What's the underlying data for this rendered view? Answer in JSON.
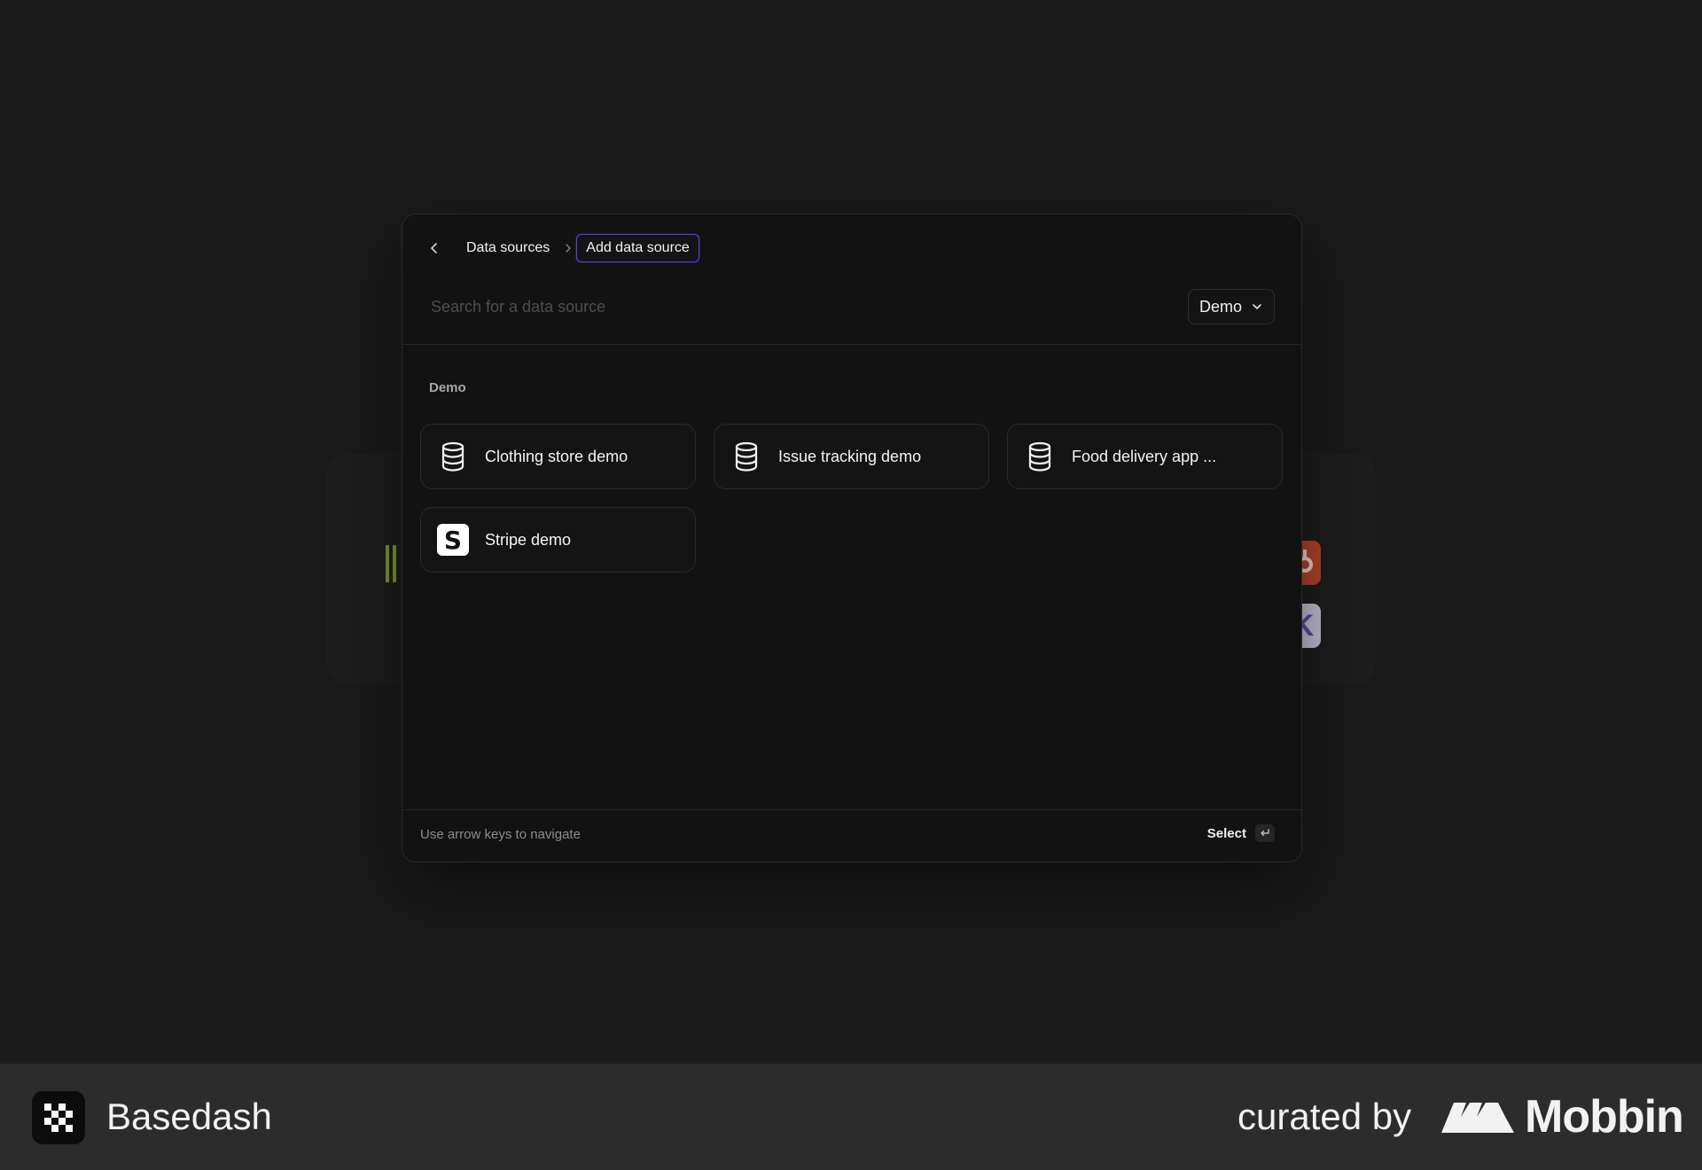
{
  "modal": {
    "breadcrumb": {
      "parent": "Data sources",
      "current": "Add data source"
    },
    "search": {
      "placeholder": "Search for a data source",
      "value": ""
    },
    "filter": {
      "selected": "Demo"
    },
    "section_label": "Demo",
    "sources": [
      {
        "label": "Clothing store demo",
        "icon": "database-icon"
      },
      {
        "label": "Issue tracking demo",
        "icon": "database-icon"
      },
      {
        "label": "Food delivery app ...",
        "icon": "database-icon"
      },
      {
        "label": "Stripe demo",
        "icon": "stripe-icon",
        "glyph": "S"
      }
    ],
    "footer": {
      "hint": "Use arrow keys to navigate",
      "action": "Select"
    }
  },
  "background": {
    "logo_hub_glyph": "ꂊ",
    "logo_k_glyph": "K"
  },
  "branding": {
    "app_name": "Basedash",
    "curated_by": "curated by",
    "curator": "Mobbin"
  },
  "colors": {
    "accent_focus": "#4d48d8",
    "background": "#1b1b1b",
    "modal": "#121212",
    "brand_bar": "#2c2c2c"
  }
}
